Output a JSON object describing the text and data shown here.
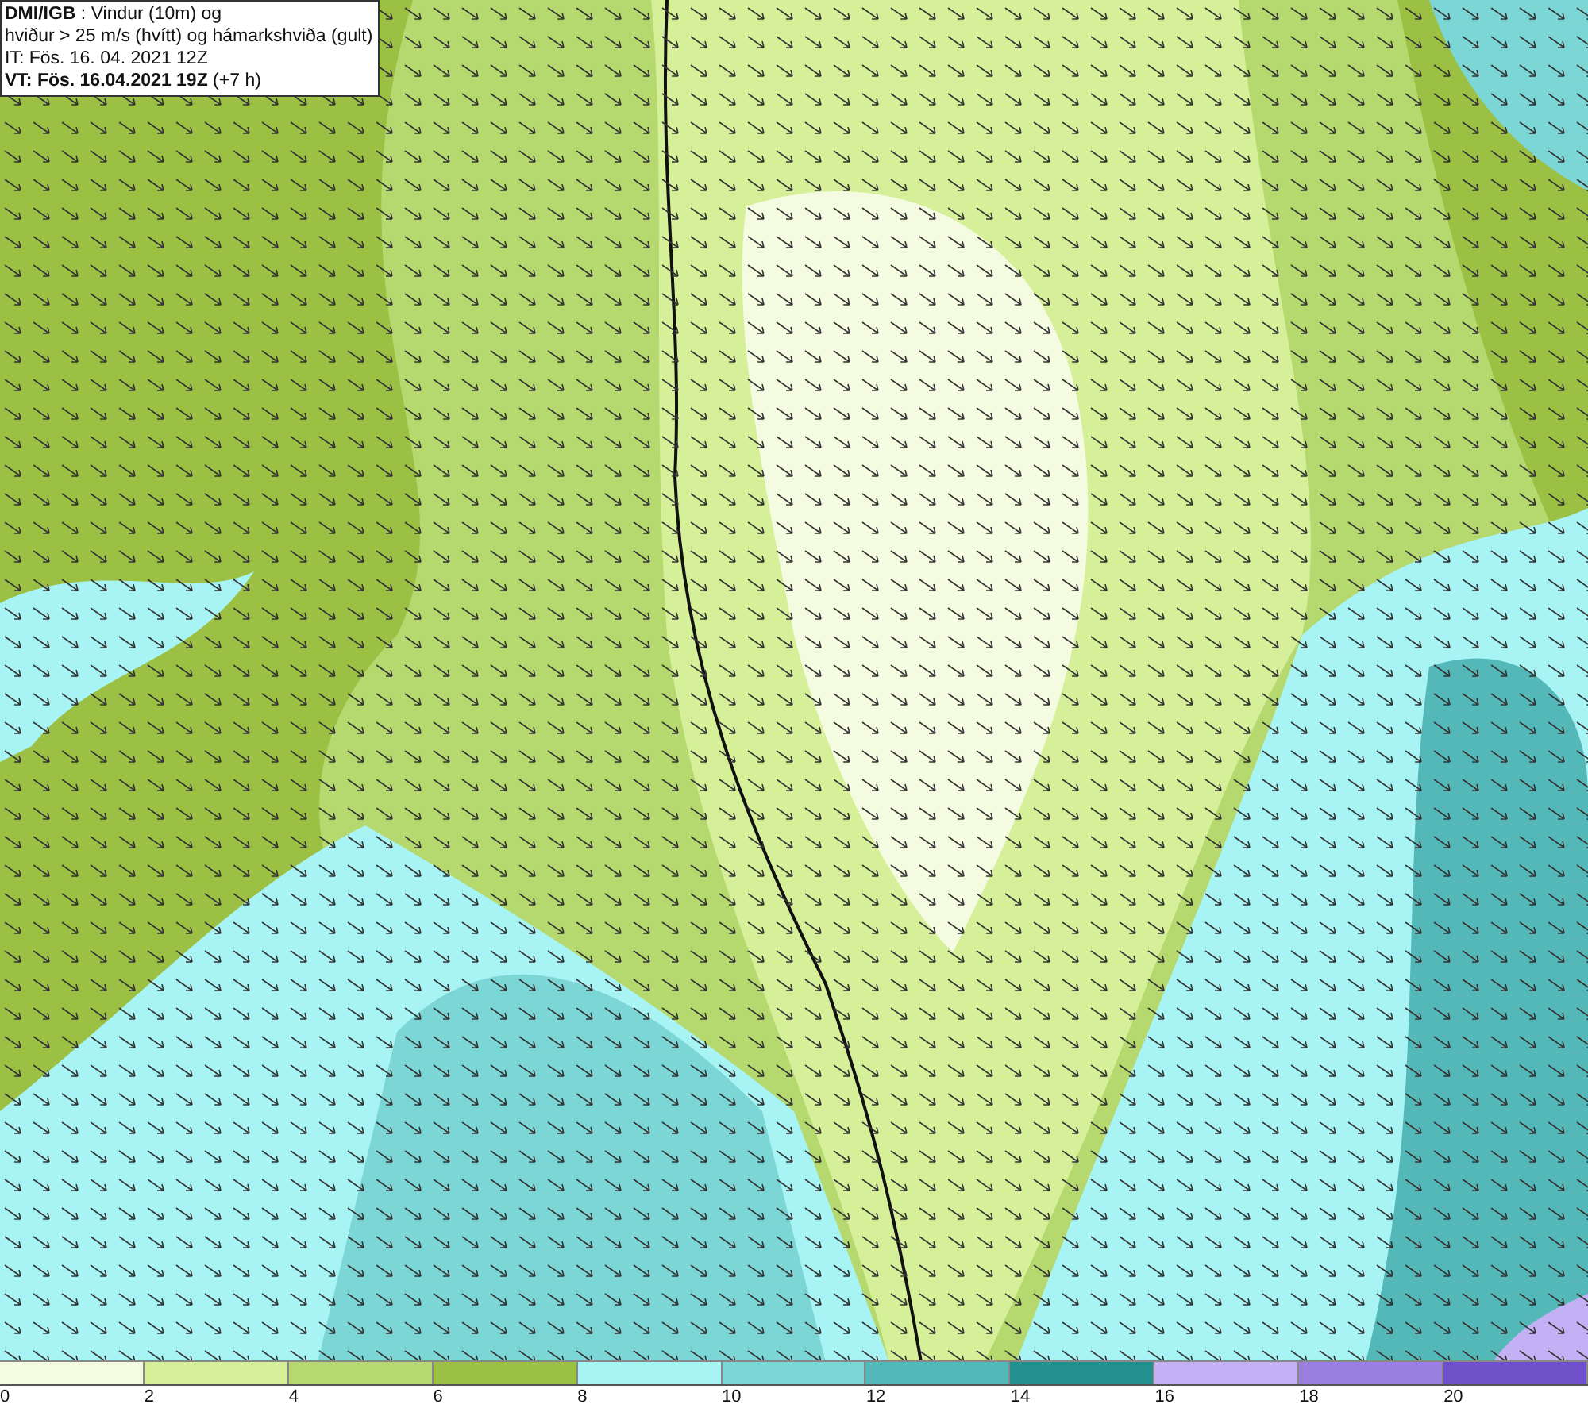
{
  "title_box": {
    "lines": [
      "**DMI/IGB** : Vindur (10m) og",
      "hviður > 25 m/s (hvítt) og hámarkshviða (gult)",
      "IT: Fös. 16. 04. 2021 12Z",
      "**VT: Fös. 16.04.2021 19Z** (+7 h)"
    ]
  },
  "legend": {
    "segments": [
      {
        "color": "#f5fbe0"
      },
      {
        "color": "#d6f09a"
      },
      {
        "color": "#b5d96e"
      },
      {
        "color": "#9bc044"
      },
      {
        "color": "#a8f4f4"
      },
      {
        "color": "#7dd6d6"
      },
      {
        "color": "#55b8b8"
      },
      {
        "color": "#238f8f"
      },
      {
        "color": "#c4b0f5"
      },
      {
        "color": "#9a7ee0"
      },
      {
        "color": "#7050c8"
      }
    ],
    "ticks": [
      "0",
      "2",
      "4",
      "6",
      "8",
      "10",
      "12",
      "14",
      "16",
      "18",
      "20"
    ]
  }
}
